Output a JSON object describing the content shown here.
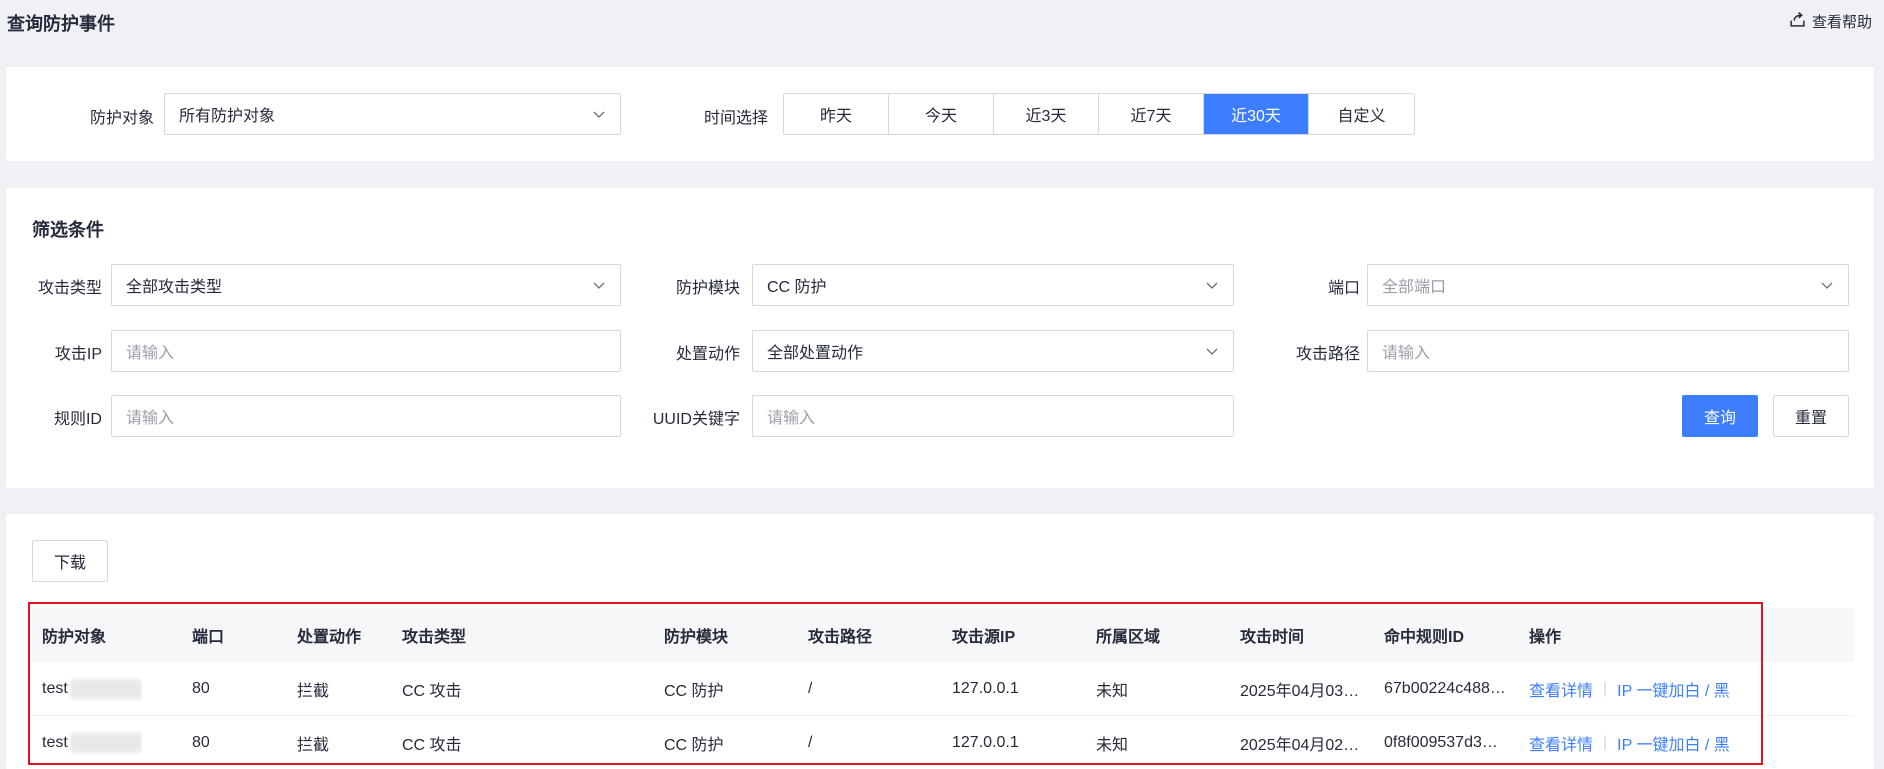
{
  "page": {
    "title": "查询防护事件",
    "help_label": "查看帮助"
  },
  "top": {
    "target_label": "防护对象",
    "target_value": "所有防护对象",
    "time_label": "时间选择",
    "time_options": [
      "昨天",
      "今天",
      "近3天",
      "近7天",
      "近30天",
      "自定义"
    ],
    "time_selected": "近30天"
  },
  "filter": {
    "title": "筛选条件",
    "attack_type_label": "攻击类型",
    "attack_type_value": "全部攻击类型",
    "module_label": "防护模块",
    "module_value": "CC 防护",
    "port_label": "端口",
    "port_placeholder": "全部端口",
    "attack_ip_label": "攻击IP",
    "attack_ip_placeholder": "请输入",
    "action_label": "处置动作",
    "action_value": "全部处置动作",
    "attack_path_label": "攻击路径",
    "attack_path_placeholder": "请输入",
    "rule_id_label": "规则ID",
    "rule_id_placeholder": "请输入",
    "uuid_label": "UUID关键字",
    "uuid_placeholder": "请输入",
    "query_label": "查询",
    "reset_label": "重置"
  },
  "table": {
    "download_label": "下载",
    "columns": [
      "防护对象",
      "端口",
      "处置动作",
      "攻击类型",
      "防护模块",
      "攻击路径",
      "攻击源IP",
      "所属区域",
      "攻击时间",
      "命中规则ID",
      "操作"
    ],
    "rows": [
      {
        "target": "test",
        "port": "80",
        "action": "拦截",
        "attack_type": "CC 攻击",
        "module": "CC 防护",
        "path": "/",
        "source_ip": "127.0.0.1",
        "region": "未知",
        "time": "2025年04月03…",
        "rule_id": "67b00224c488…",
        "op_detail": "查看详情",
        "op_ip": "IP 一键加白 / 黑"
      },
      {
        "target": "test",
        "port": "80",
        "action": "拦截",
        "attack_type": "CC 攻击",
        "module": "CC 防护",
        "path": "/",
        "source_ip": "127.0.0.1",
        "region": "未知",
        "time": "2025年04月02…",
        "rule_id": "0f8f009537d3…",
        "op_detail": "查看详情",
        "op_ip": "IP 一键加白 / 黑"
      }
    ]
  },
  "colors": {
    "accent": "#3c7eff",
    "highlight": "#e0141e",
    "background": "#eff1f5"
  }
}
